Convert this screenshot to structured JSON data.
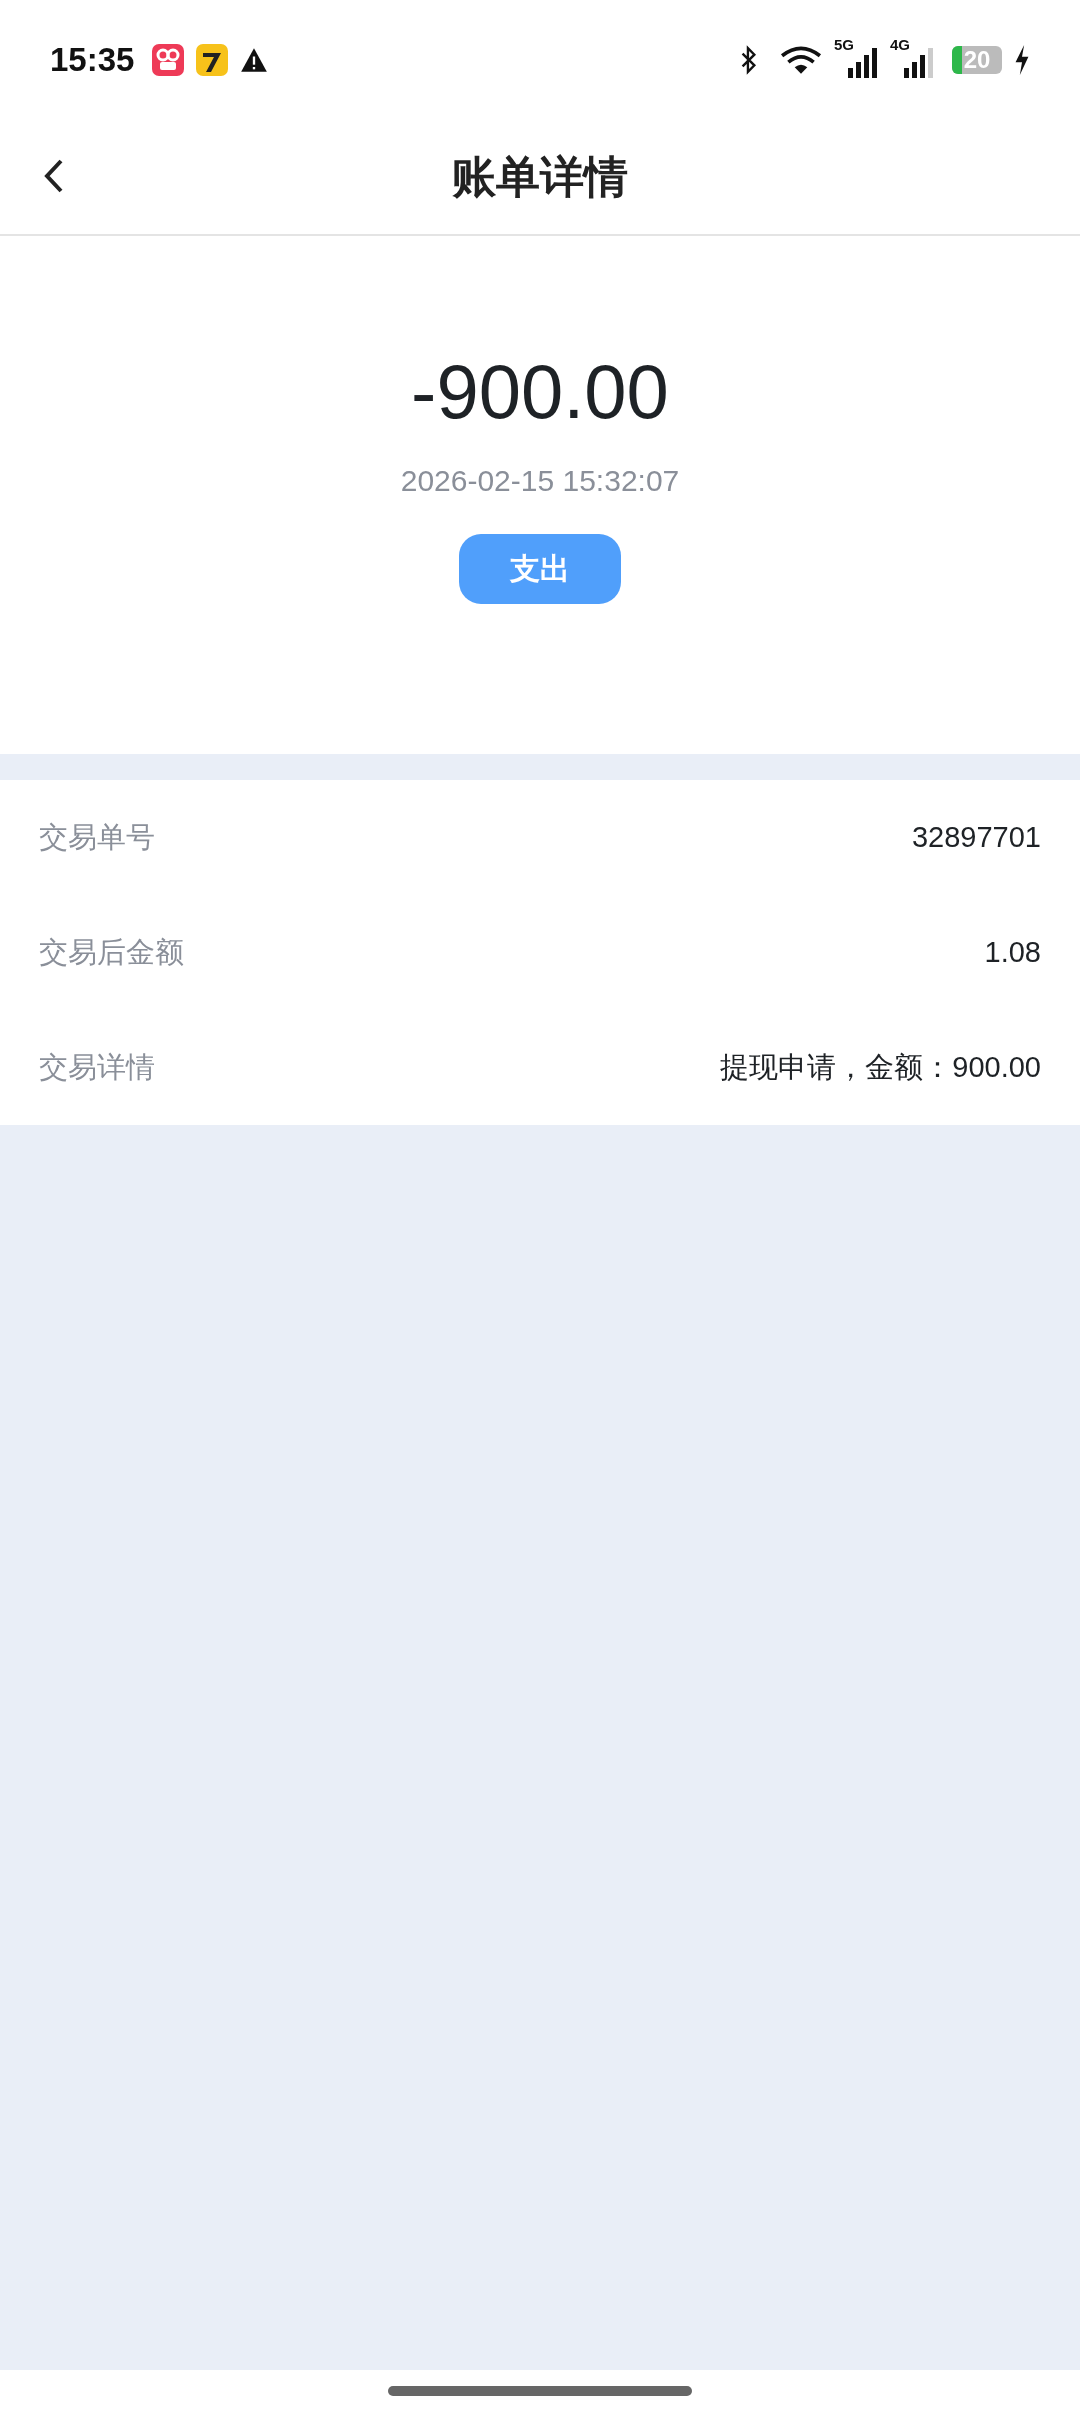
{
  "status_bar": {
    "time": "15:35",
    "signals": [
      {
        "label": "5G",
        "kind": "full"
      },
      {
        "label": "4G",
        "kind": "partial"
      }
    ],
    "battery": "20"
  },
  "header": {
    "title": "账单详情"
  },
  "summary": {
    "amount": "-900.00",
    "datetime": "2026-02-15 15:32:07",
    "tag": "支出"
  },
  "details": [
    {
      "label": "交易单号",
      "value": "32897701"
    },
    {
      "label": "交易后金额",
      "value": "1.08"
    },
    {
      "label": "交易详情",
      "value": "提现申请，金额：900.00"
    }
  ]
}
